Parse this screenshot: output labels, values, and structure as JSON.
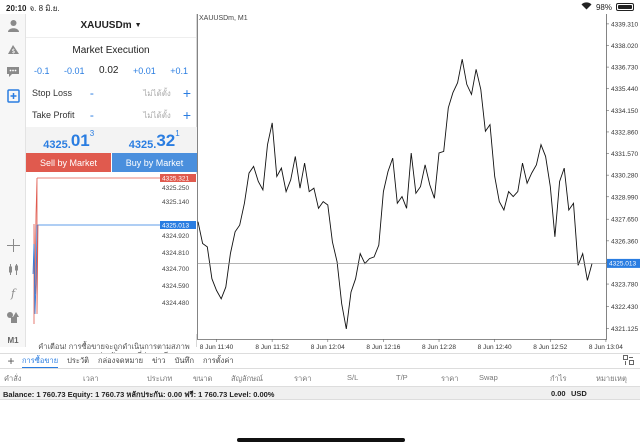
{
  "status": {
    "time": "20:10",
    "date": "จ. 8 มิ.ย.",
    "battery": "98%"
  },
  "left_tools": [
    "person-icon",
    "finance-icon",
    "chat-icon",
    "new-order-icon",
    "crosshair-icon",
    "candles-icon",
    "function-icon",
    "objects-icon",
    "M1"
  ],
  "order": {
    "symbol": "XAUUSDm",
    "execution": "Market Execution",
    "volume_adjust": [
      "-0.1",
      "-0.01",
      "0.02",
      "+0.01",
      "+0.1"
    ],
    "stop_loss": {
      "label": "Stop Loss",
      "minus": "-",
      "value": "ไม่ได้ตั้ง",
      "plus": "+"
    },
    "take_profit": {
      "label": "Take Profit",
      "minus": "-",
      "value": "ไม่ได้ตั้ง",
      "plus": "+"
    },
    "bid": {
      "small": "4325.",
      "big": "01",
      "sup": "3"
    },
    "ask": {
      "small": "4325.",
      "big": "32",
      "sup": "1"
    },
    "sell_label": "Sell by Market",
    "buy_label": "Buy by Market",
    "mini_prices": [
      "4325.250",
      "4325.140",
      "4324.920",
      "4324.810",
      "4324.700",
      "4324.590",
      "4324.480"
    ],
    "mini_ask_tag": "4325.321",
    "mini_bid_tag": "4325.013",
    "warning": "คำเตือน! การซื้อขายจะถูกดำเนินการตามสภาพตลาด ความแตกต่างกับราคาที่ส่งอาจมีมาก!",
    "colors": {
      "sell": "#e05a4e",
      "buy": "#4a8fdd",
      "accent": "#2a7de1"
    }
  },
  "chart": {
    "title": "XAUUSDm, M1",
    "current_price_tag": "4325.013"
  },
  "chart_data": {
    "type": "line",
    "title": "XAUUSDm, M1",
    "xlabel": "",
    "ylabel": "",
    "x_ticks": [
      "8 Jun 11:40",
      "8 Jun 11:52",
      "8 Jun 12:04",
      "8 Jun 12:16",
      "8 Jun 12:28",
      "8 Jun 12:40",
      "8 Jun 12:52",
      "8 Jun 13:04"
    ],
    "y_ticks": [
      "4339.310",
      "4338.020",
      "4336.730",
      "4335.440",
      "4334.150",
      "4332.860",
      "4331.570",
      "4330.280",
      "4328.990",
      "4327.650",
      "4326.360",
      "4325.070",
      "4323.780",
      "4322.430",
      "4321.125"
    ],
    "ylim": [
      4320.5,
      4339.9
    ],
    "current_price": 4325.013,
    "series": [
      {
        "values": [
          4327.5,
          4326.2,
          4326.0,
          4324.1,
          4323.4,
          4322.9,
          4323.6,
          4325.6,
          4326.9,
          4327.3,
          4328.6,
          4330.4,
          4330.8,
          4329.9,
          4329.4,
          4332.1,
          4333.4,
          4330.2,
          4330.7,
          4329.3,
          4330.0,
          4331.4,
          4329.5,
          4331.0,
          4329.3,
          4329.5,
          4328.3,
          4328.7,
          4328.5,
          4326.3,
          4325.1,
          4322.6,
          4321.1,
          4323.3,
          4324.1,
          4325.6,
          4325.0,
          4325.3,
          4325.4,
          4326.1,
          4329.3,
          4330.5,
          4331.3,
          4328.6,
          4329.0,
          4328.3,
          4331.6,
          4329.2,
          4329.6,
          4330.9,
          4329.7,
          4328.9,
          4331.6,
          4331.7,
          4334.3,
          4335.2,
          4335.8,
          4337.2,
          4335.7,
          4335.1,
          4336.6,
          4335.4,
          4332.9,
          4333.3,
          4330.2,
          4328.7,
          4328.2,
          4329.3,
          4329.0,
          4329.3,
          4331.0,
          4329.8,
          4330.4,
          4330.9,
          4332.1,
          4331.4,
          4329.6,
          4326.6,
          4329.9,
          4330.7,
          4328.2,
          4328.6,
          4324.9,
          4325.6,
          4324.0,
          4325.0
        ]
      }
    ]
  },
  "bottom_tabs": [
    "การซื้อขาย",
    "ประวัติ",
    "กล่องจดหมาย",
    "ข่าว",
    "บันทึก",
    "การตั้งค่า"
  ],
  "columns": [
    "คำสั่ง",
    "เวลา",
    "ประเภท",
    "ขนาด",
    "สัญลักษณ์",
    "ราคา",
    "S/L",
    "T/P",
    "ราคา",
    "Swap",
    "กำไร",
    "หมายเหตุ"
  ],
  "balance": {
    "summary": "Balance: 1 760.73 Equity: 1 760.73 หลักประกัน: 0.00 ฟรี: 1 760.73 Level: 0.00%",
    "profit": "0.00",
    "currency": "USD"
  }
}
